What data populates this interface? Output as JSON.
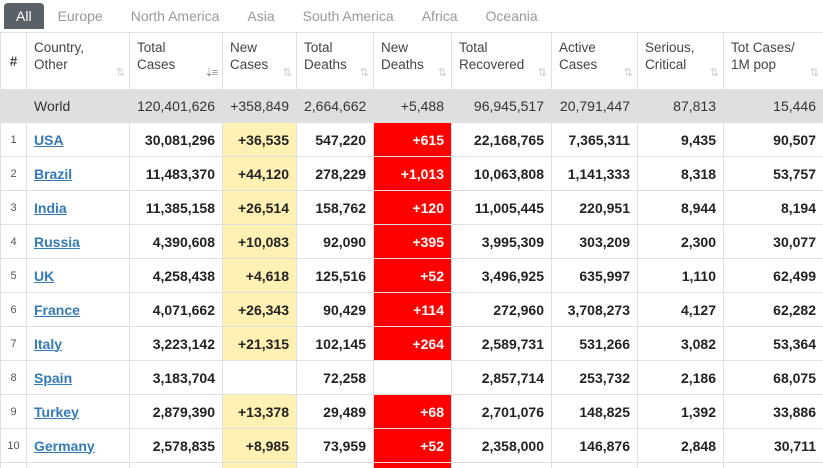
{
  "tabs": [
    "All",
    "Europe",
    "North America",
    "Asia",
    "South America",
    "Africa",
    "Oceania"
  ],
  "colors": {
    "new_cases_bg": "#fff0b3",
    "new_deaths_bg": "#ff0000",
    "world_row_bg": "#dfdfdf",
    "link": "#337ab7",
    "active_tab_bg": "#5a6067"
  },
  "headers": {
    "hash": "#",
    "country": [
      "Country,",
      "Other"
    ],
    "total_cases": [
      "Total",
      "Cases"
    ],
    "new_cases": [
      "New",
      "Cases"
    ],
    "total_deaths": [
      "Total",
      "Deaths"
    ],
    "new_deaths": [
      "New",
      "Deaths"
    ],
    "total_recovered": [
      "Total",
      "Recovered"
    ],
    "active_cases": [
      "Active",
      "Cases"
    ],
    "serious": [
      "Serious,",
      "Critical"
    ],
    "per_million": [
      "Tot Cases/",
      "1M pop"
    ]
  },
  "sort_icons": {
    "default": "⇅",
    "active": "⇣≡"
  },
  "world": {
    "country": "World",
    "total_cases": "120,401,626",
    "new_cases": "+358,849",
    "total_deaths": "2,664,662",
    "new_deaths": "+5,488",
    "total_recovered": "96,945,517",
    "active_cases": "20,791,447",
    "serious": "87,813",
    "per_million": "15,446"
  },
  "rows": [
    {
      "num": "1",
      "country": "USA",
      "total_cases": "30,081,296",
      "new_cases": "+36,535",
      "total_deaths": "547,220",
      "new_deaths": "+615",
      "total_recovered": "22,168,765",
      "active_cases": "7,365,311",
      "serious": "9,435",
      "per_million": "90,507"
    },
    {
      "num": "2",
      "country": "Brazil",
      "total_cases": "11,483,370",
      "new_cases": "+44,120",
      "total_deaths": "278,229",
      "new_deaths": "+1,013",
      "total_recovered": "10,063,808",
      "active_cases": "1,141,333",
      "serious": "8,318",
      "per_million": "53,757"
    },
    {
      "num": "3",
      "country": "India",
      "total_cases": "11,385,158",
      "new_cases": "+26,514",
      "total_deaths": "158,762",
      "new_deaths": "+120",
      "total_recovered": "11,005,445",
      "active_cases": "220,951",
      "serious": "8,944",
      "per_million": "8,194"
    },
    {
      "num": "4",
      "country": "Russia",
      "total_cases": "4,390,608",
      "new_cases": "+10,083",
      "total_deaths": "92,090",
      "new_deaths": "+395",
      "total_recovered": "3,995,309",
      "active_cases": "303,209",
      "serious": "2,300",
      "per_million": "30,077"
    },
    {
      "num": "5",
      "country": "UK",
      "total_cases": "4,258,438",
      "new_cases": "+4,618",
      "total_deaths": "125,516",
      "new_deaths": "+52",
      "total_recovered": "3,496,925",
      "active_cases": "635,997",
      "serious": "1,110",
      "per_million": "62,499"
    },
    {
      "num": "6",
      "country": "France",
      "total_cases": "4,071,662",
      "new_cases": "+26,343",
      "total_deaths": "90,429",
      "new_deaths": "+114",
      "total_recovered": "272,960",
      "active_cases": "3,708,273",
      "serious": "4,127",
      "per_million": "62,282"
    },
    {
      "num": "7",
      "country": "Italy",
      "total_cases": "3,223,142",
      "new_cases": "+21,315",
      "total_deaths": "102,145",
      "new_deaths": "+264",
      "total_recovered": "2,589,731",
      "active_cases": "531,266",
      "serious": "3,082",
      "per_million": "53,364"
    },
    {
      "num": "8",
      "country": "Spain",
      "total_cases": "3,183,704",
      "new_cases": "",
      "total_deaths": "72,258",
      "new_deaths": "",
      "total_recovered": "2,857,714",
      "active_cases": "253,732",
      "serious": "2,186",
      "per_million": "68,075"
    },
    {
      "num": "9",
      "country": "Turkey",
      "total_cases": "2,879,390",
      "new_cases": "+13,378",
      "total_deaths": "29,489",
      "new_deaths": "+68",
      "total_recovered": "2,701,076",
      "active_cases": "148,825",
      "serious": "1,392",
      "per_million": "33,886"
    },
    {
      "num": "10",
      "country": "Germany",
      "total_cases": "2,578,835",
      "new_cases": "+8,985",
      "total_deaths": "73,959",
      "new_deaths": "+52",
      "total_recovered": "2,358,000",
      "active_cases": "146,876",
      "serious": "2,848",
      "per_million": "30,711"
    }
  ]
}
